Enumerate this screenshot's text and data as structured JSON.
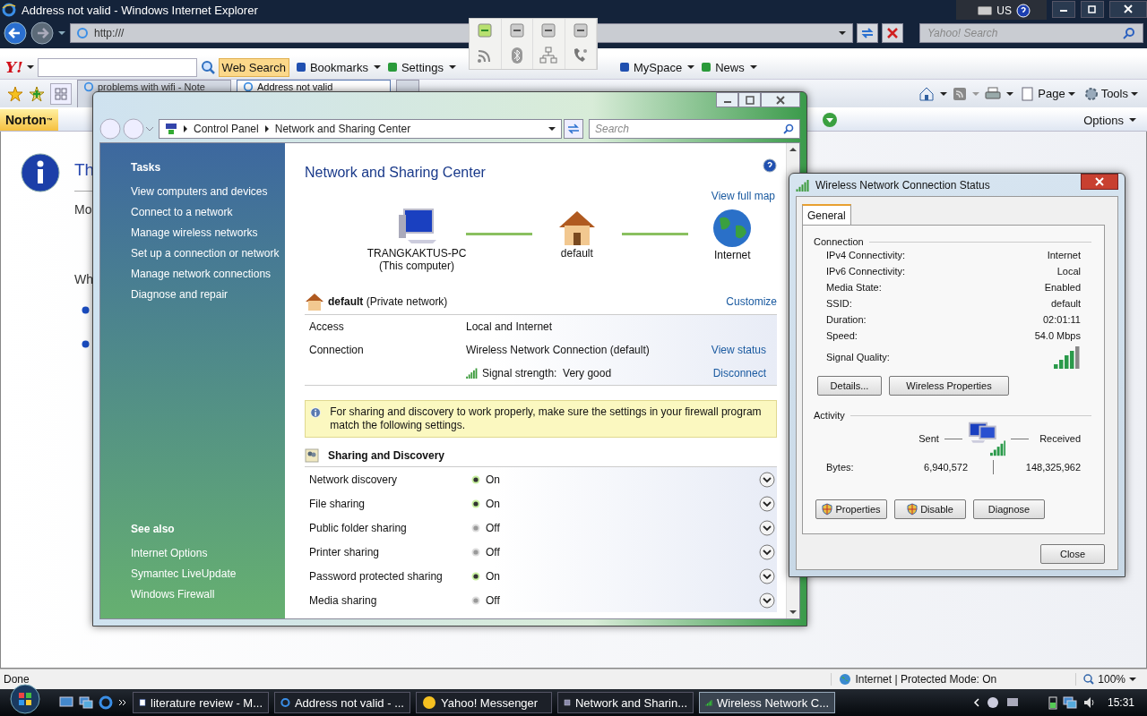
{
  "browser": {
    "title": "Address not valid - Windows Internet Explorer",
    "address": "http:///",
    "search_placeholder": "Yahoo! Search",
    "language": "US",
    "yahoo": {
      "logo": "Y!",
      "search_button": "Web Search",
      "items": [
        "Bookmarks",
        "Settings",
        "MySpace",
        "News"
      ]
    },
    "tabs": [
      {
        "label": "problems with wifi - Note",
        "selected": false
      },
      {
        "label": "Address not valid",
        "selected": true
      }
    ],
    "commands": [
      "Page",
      "Tools"
    ],
    "norton": {
      "brand": "Norton",
      "trademark": "™",
      "options": "Options"
    },
    "page_fragments": [
      "Th",
      "Mo",
      "Wh"
    ],
    "status": {
      "text": "Done",
      "zone": "Internet | Protected Mode: On",
      "zoom": "100%"
    }
  },
  "quick_toggles": [
    {
      "on": true
    },
    {
      "on": false
    },
    {
      "on": false
    },
    {
      "on": false
    }
  ],
  "network_center": {
    "breadcrumb": [
      "Control Panel",
      "Network and Sharing Center"
    ],
    "search_placeholder": "Search",
    "tasks_heading": "Tasks",
    "tasks": [
      "View computers and devices",
      "Connect to a network",
      "Manage wireless networks",
      "Set up a connection or network",
      "Manage network connections",
      "Diagnose and repair"
    ],
    "see_also_heading": "See also",
    "see_also": [
      "Internet Options",
      "Symantec LiveUpdate",
      "Windows Firewall"
    ],
    "title": "Network and Sharing Center",
    "view_full_map": "View full map",
    "map": [
      {
        "kind": "computer",
        "label": "TRANGKAKTUS-PC",
        "sublabel": "(This computer)"
      },
      {
        "kind": "house",
        "label": "default"
      },
      {
        "kind": "globe",
        "label": "Internet"
      }
    ],
    "network": {
      "name": "default",
      "type": "(Private network)",
      "customize": "Customize",
      "rows": [
        {
          "kind": "text",
          "label": "Access",
          "value": "Local and Internet"
        },
        {
          "kind": "text",
          "label": "Connection",
          "value": "Wireless Network Connection (default)",
          "action": "View status"
        },
        {
          "kind": "signal",
          "value": "Signal strength:  Very good",
          "action": "Disconnect"
        }
      ]
    },
    "notice": "For sharing and discovery to work properly, make sure the settings in your firewall program match the following settings.",
    "sharing_heading": "Sharing and Discovery",
    "sharing": [
      {
        "name": "Network discovery",
        "on": true,
        "status": "On"
      },
      {
        "name": "File sharing",
        "on": true,
        "status": "On"
      },
      {
        "name": "Public folder sharing",
        "on": false,
        "status": "Off"
      },
      {
        "name": "Printer sharing",
        "on": false,
        "status": "Off"
      },
      {
        "name": "Password protected sharing",
        "on": true,
        "status": "On"
      },
      {
        "name": "Media sharing",
        "on": false,
        "status": "Off"
      }
    ]
  },
  "status_dialog": {
    "title": "Wireless Network Connection Status",
    "tabs": [
      {
        "label": "General",
        "selected": true
      }
    ],
    "connection_heading": "Connection",
    "fields": [
      {
        "label": "IPv4 Connectivity:",
        "value": "Internet"
      },
      {
        "label": "IPv6 Connectivity:",
        "value": "Local"
      },
      {
        "label": "Media State:",
        "value": "Enabled"
      },
      {
        "label": "SSID:",
        "value": "default"
      },
      {
        "label": "Duration:",
        "value": "02:01:11"
      },
      {
        "label": "Speed:",
        "value": "54.0 Mbps"
      }
    ],
    "signal_label": "Signal Quality:",
    "buttons": [
      "Details...",
      "Wireless Properties"
    ],
    "activity_heading": "Activity",
    "sent_label": "Sent",
    "received_label": "Received",
    "bytes_label": "Bytes:",
    "sent": "6,940,572",
    "received": "148,325,962",
    "actions": [
      {
        "label": "Properties",
        "shield": true
      },
      {
        "label": "Disable",
        "shield": true
      },
      {
        "label": "Diagnose",
        "shield": false
      }
    ],
    "close": "Close"
  },
  "taskbar": {
    "items": [
      {
        "label": "literature review - M...",
        "kind": "doc",
        "selected": false
      },
      {
        "label": "Address not valid - ...",
        "kind": "ie",
        "selected": false
      },
      {
        "label": "Yahoo! Messenger",
        "kind": "smiley",
        "selected": false
      },
      {
        "label": "Network and Sharin...",
        "kind": "network",
        "selected": false
      },
      {
        "label": "Wireless Network C...",
        "kind": "signal",
        "selected": true
      }
    ],
    "time": "15:31"
  }
}
